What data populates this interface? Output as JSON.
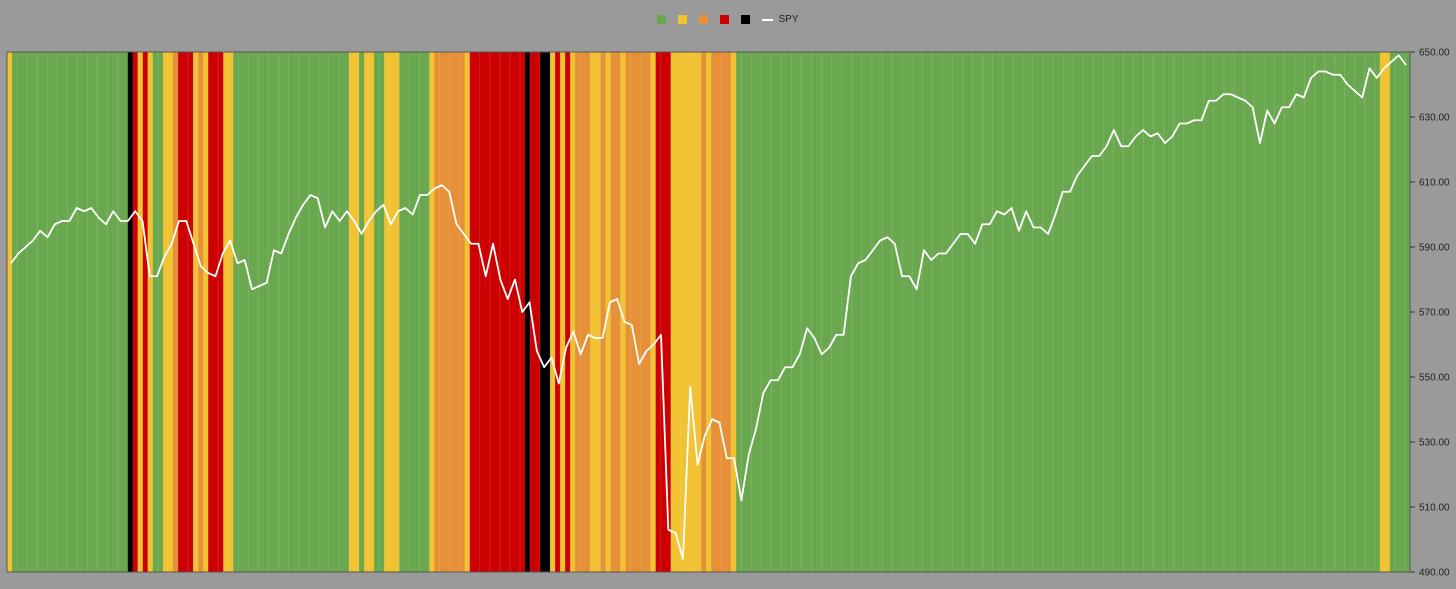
{
  "chart_data": {
    "type": "line",
    "background_bands": "one colored band per day showing regime",
    "regime_colors": {
      "G": "#6aa84f",
      "Y": "#f1c232",
      "O": "#e69138",
      "R": "#cc0000",
      "K": "#000000"
    },
    "legend": [
      {
        "key": "G",
        "color": "#6aa84f",
        "label": ""
      },
      {
        "key": "Y",
        "color": "#f1c232",
        "label": ""
      },
      {
        "key": "O",
        "color": "#e69138",
        "label": ""
      },
      {
        "key": "R",
        "color": "#cc0000",
        "label": ""
      },
      {
        "key": "K",
        "color": "#000000",
        "label": ""
      },
      {
        "key": "SPY",
        "color": "#ffffff",
        "label": "SPY",
        "line": true
      }
    ],
    "legend_placement": "top-center",
    "y_axis": {
      "position": "right",
      "ylim": [
        490,
        650
      ],
      "ticks": [
        "650.00",
        "630.00",
        "610.00",
        "590.00",
        "570.00",
        "550.00",
        "530.00",
        "510.00",
        "490.00"
      ],
      "tick_values": [
        650,
        630,
        610,
        590,
        570,
        550,
        530,
        510,
        490
      ]
    },
    "grid": "vertical lines between bands",
    "series": [
      {
        "name": "SPY",
        "color": "#ffffff",
        "values": [
          585,
          588,
          590,
          592,
          595,
          593,
          597,
          598,
          598,
          602,
          601,
          602,
          599,
          597,
          601,
          598,
          598,
          601,
          598,
          581,
          581,
          587,
          591,
          598,
          598,
          591,
          584,
          582,
          581,
          588,
          592,
          585,
          586,
          577,
          578,
          579,
          589,
          588,
          594,
          599,
          603,
          606,
          605,
          596,
          601,
          598,
          601,
          598,
          594,
          598,
          601,
          603,
          597,
          601,
          602,
          600,
          606,
          606,
          608,
          609,
          607,
          597,
          594,
          591,
          591,
          581,
          591,
          580,
          574,
          580,
          570,
          573,
          558,
          553,
          556,
          548,
          559,
          564,
          557,
          563,
          562,
          562,
          573,
          574,
          567,
          566,
          554,
          558,
          560,
          563,
          503,
          502,
          494,
          547,
          523,
          532,
          537,
          536,
          525,
          525,
          512,
          526,
          534,
          545,
          549,
          549,
          553,
          553,
          557,
          565,
          562,
          557,
          559,
          563,
          563,
          581,
          585,
          586,
          589,
          592,
          593,
          591,
          581,
          581,
          577,
          589,
          586,
          588,
          588,
          591,
          594,
          594,
          591,
          597,
          597,
          601,
          600,
          602,
          595,
          601,
          596,
          596,
          594,
          600,
          607,
          607,
          612,
          615,
          618,
          618,
          621,
          626,
          621,
          621,
          624,
          626,
          624,
          625,
          622,
          624,
          628,
          628,
          629,
          629,
          635,
          635,
          637,
          637,
          636,
          635,
          633,
          622,
          632,
          628,
          633,
          633,
          637,
          636,
          642,
          644,
          644,
          643,
          643,
          640,
          638,
          636,
          645,
          642,
          645,
          647,
          649,
          646
        ]
      }
    ],
    "regimes": "YGGGGGGGGGGGGGGGGGGGGGGGKRYRYGGYYORRRYOYRRRYYGGGGGGGGGGGGGGGGGGGGGGGYYGYYGGYYYGGGGGGYOOOOOOYRRRRRRRRRRRKRRKKYRYRYOOOYYOYOOYOOOOOYRRRYYYYYYOYOOOOYGGGGGGGGGGGGGGGGGGGGGGGGGGGGGGGGGGGGGGGGGGGGGGGGGGGGGGGGGGGGGGGGGGGGGGGGGGGGGGGGGGGGGGGGGGGGGGGGGGGGGGGGGGGGGGGGGGGGGGGGGGGGGGGGYYGGGG"
  }
}
